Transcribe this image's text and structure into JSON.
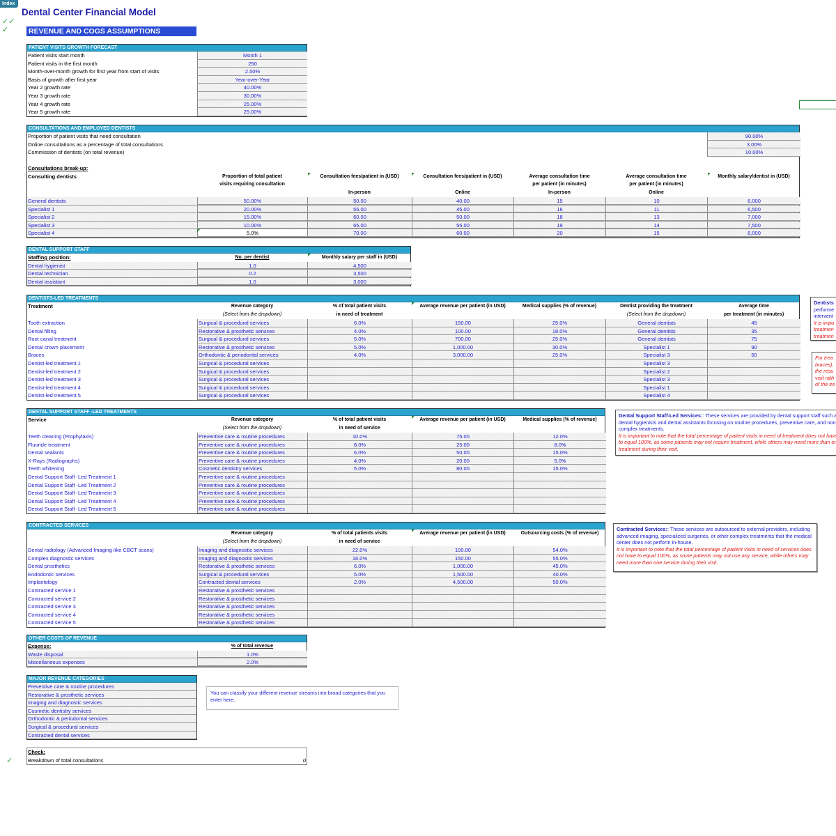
{
  "index_button": "Index",
  "title": "Dental Center Financial Model",
  "check_marks": [
    "✓✓",
    "✓"
  ],
  "section_title": "REVENUE AND COGS ASSUMPTIONS",
  "growth": {
    "header": "PATIENT VISITS GROWTH FORECAST",
    "rows": [
      {
        "label": "Patient visits start month",
        "value": "Month 1"
      },
      {
        "label": "Patient visits in the first month",
        "value": "250"
      },
      {
        "label": "Month-over-month growth for first year from start of visits",
        "value": "2.50%"
      },
      {
        "label": "Basis of growth after first year",
        "value": "Year-over-Year"
      },
      {
        "label": "Year 2 growth rate",
        "value": "40.00%"
      },
      {
        "label": "Year 3 growth rate",
        "value": "30.00%"
      },
      {
        "label": "Year 4 growth rate",
        "value": "25.00%"
      },
      {
        "label": "Year 5 growth rate",
        "value": "25.00%"
      }
    ]
  },
  "consult": {
    "header": "CONSULTATIONS AND EMPLOYED DENTISTS",
    "params": [
      {
        "label": "Proportion of patient visits that need consultation",
        "value": "90.00%"
      },
      {
        "label": "Online consultations as a percentage of total consultations",
        "value": "3.00%"
      },
      {
        "label": "Commission of dentists (on total revenue)",
        "value": "10.00%"
      }
    ],
    "breakup_label": "Consultations break-up:",
    "col_headers": {
      "name": "Consulting dentists",
      "proportion_1": "Proportion of total patient",
      "proportion_2": "visits requiring consultation",
      "fee_in": "Consultation fees/patient  in (USD)",
      "fee_in_sub": "In-person",
      "fee_on": "Consultation fees/patient  in (USD)",
      "fee_on_sub": "Online",
      "time_in_1": "Average consultation time",
      "time_in_2": "per patient (in minutes)",
      "time_in_sub": "In-person",
      "time_on_1": "Average consultation time",
      "time_on_2": "per patient (in minutes)",
      "time_on_sub": "Online",
      "salary": "Monthly salary/dentist  in (USD)"
    },
    "rows": [
      {
        "name": "General dentists",
        "proportion": "50.00%",
        "fee_in": "50.00",
        "fee_on": "40.00",
        "time_in": "15",
        "time_on": "10",
        "salary": "6,000"
      },
      {
        "name": "Specialist 1",
        "proportion": "20.00%",
        "fee_in": "55.00",
        "fee_on": "45.00",
        "time_in": "16",
        "time_on": "11",
        "salary": "6,500"
      },
      {
        "name": "Specialist 2",
        "proportion": "15.00%",
        "fee_in": "60.00",
        "fee_on": "50.00",
        "time_in": "18",
        "time_on": "13",
        "salary": "7,000"
      },
      {
        "name": "Specialist 3",
        "proportion": "10.00%",
        "fee_in": "65.00",
        "fee_on": "55.00",
        "time_in": "19",
        "time_on": "14",
        "salary": "7,500"
      },
      {
        "name": "Specialist 4",
        "proportion": "5.0%",
        "fee_in": "70.00",
        "fee_on": "60.00",
        "time_in": "20",
        "time_on": "15",
        "salary": "8,000"
      }
    ]
  },
  "staff": {
    "header": "DENTAL SUPPORT STAFF",
    "col_headers": {
      "position": "Staffing position:",
      "per_dentist": "No. per dentist",
      "salary": "Monthly salary per staff in (USD)"
    },
    "rows": [
      {
        "position": "Dental hygienist",
        "per_dentist": "1.0",
        "salary": "4,500"
      },
      {
        "position": "Dental technician",
        "per_dentist": "0.2",
        "salary": "3,500"
      },
      {
        "position": "Dental assistant",
        "per_dentist": "1.0",
        "salary": "3,000"
      }
    ]
  },
  "dentist_treatments": {
    "header": "DENTISTS-LED TREATMENTS",
    "col_headers": {
      "name": "Treatment",
      "category": "Revenue category",
      "category_sub": "(Select from the dropdown)",
      "pct_1": "% of total patient visits",
      "pct_2": "in need of treatment",
      "revenue": "Average revenue per patient (in USD)",
      "supplies": "Medical supplies (% of revenue)",
      "dentist": "Dentist providing the treatment",
      "dentist_sub": "(Select from the dropdown)",
      "time_1": "Average time",
      "time_2": "per treatment (in minutes)"
    },
    "rows": [
      {
        "name": "Tooth extraction",
        "category": "Surgical & procedural services",
        "pct": "6.0%",
        "revenue": "150.00",
        "supplies": "25.0%",
        "dentist": "General dentists",
        "time": "45"
      },
      {
        "name": "Dental filling",
        "category": "Restorative & prosthetic services",
        "pct": "4.0%",
        "revenue": "100.00",
        "supplies": "18.0%",
        "dentist": "General dentists",
        "time": "35"
      },
      {
        "name": "Root canal treatment",
        "category": "Surgical & procedural services",
        "pct": "5.0%",
        "revenue": "700.00",
        "supplies": "25.0%",
        "dentist": "General dentists",
        "time": "75"
      },
      {
        "name": "Dental crown placement",
        "category": "Restorative & prosthetic services",
        "pct": "5.0%",
        "revenue": "1,000.00",
        "supplies": "30.0%",
        "dentist": "Specialist 1",
        "time": "90"
      },
      {
        "name": "Braces",
        "category": "Orthodontic & periodontal services",
        "pct": "4.0%",
        "revenue": "3,000.00",
        "supplies": "25.0%",
        "dentist": "Specialist 3",
        "time": "50"
      },
      {
        "name": "Dentist-led treatment 1",
        "category": "Surgical & procedural services",
        "pct": "",
        "revenue": "",
        "supplies": "",
        "dentist": "Specialist 3",
        "time": ""
      },
      {
        "name": "Dentist-led treatment 2",
        "category": "Surgical & procedural services",
        "pct": "",
        "revenue": "",
        "supplies": "",
        "dentist": "Specialist 2",
        "time": ""
      },
      {
        "name": "Dentist-led treatment 3",
        "category": "Surgical & procedural services",
        "pct": "",
        "revenue": "",
        "supplies": "",
        "dentist": "Specialist 3",
        "time": ""
      },
      {
        "name": "Dentist-led treatment 4",
        "category": "Surgical & procedural services",
        "pct": "",
        "revenue": "",
        "supplies": "",
        "dentist": "Specialist 1",
        "time": ""
      },
      {
        "name": "Dentist-led treatment 5",
        "category": "Surgical & procedural services",
        "pct": "",
        "revenue": "",
        "supplies": "",
        "dentist": "Specialist 4",
        "time": ""
      }
    ],
    "note_1": {
      "title": "Dentists",
      "lines": [
        "performe",
        "intervent"
      ],
      "red": [
        "It is impo",
        "treatmen",
        "treatmen"
      ]
    },
    "note_2": {
      "red": [
        "For trea",
        "braces),",
        "the resu",
        "visit rath",
        "of the tre"
      ]
    }
  },
  "support_treatments": {
    "header": "DENTAL SUPPORT STAFF -LED TREATMENTS",
    "col_headers": {
      "name": "Service",
      "category": "Revenue category",
      "category_sub": "(Select from the dropdown)",
      "pct_1": "% of total patient visits",
      "pct_2": "in need of service",
      "revenue": "Average revenue per patient (in USD)",
      "supplies": "Medical supplies (% of revenue)"
    },
    "rows": [
      {
        "name": "Teeth cleaning (Prophylaxis)",
        "category": "Preventive care & routine procedures",
        "pct": "10.0%",
        "revenue": "75.00",
        "supplies": "12.0%"
      },
      {
        "name": "Fluoride treatment",
        "category": "Preventive care & routine procedures",
        "pct": "8.0%",
        "revenue": "25.00",
        "supplies": "8.0%"
      },
      {
        "name": "Dental sealants",
        "category": "Preventive care & routine procedures",
        "pct": "6.0%",
        "revenue": "50.00",
        "supplies": "15.0%"
      },
      {
        "name": "X-Rays (Radiographs)",
        "category": "Preventive care & routine procedures",
        "pct": "4.0%",
        "revenue": "20.00",
        "supplies": "5.0%"
      },
      {
        "name": "Teeth whitening",
        "category": "Cosmetic dentistry services",
        "pct": "5.0%",
        "revenue": "80.00",
        "supplies": "15.0%"
      },
      {
        "name": "Dental Support Staff -Led Treatment 1",
        "category": "Preventive care & routine procedures",
        "pct": "",
        "revenue": "",
        "supplies": ""
      },
      {
        "name": "Dental Support Staff -Led Treatment 2",
        "category": "Preventive care & routine procedures",
        "pct": "",
        "revenue": "",
        "supplies": ""
      },
      {
        "name": "Dental Support Staff -Led Treatment 3",
        "category": "Preventive care & routine procedures",
        "pct": "",
        "revenue": "",
        "supplies": ""
      },
      {
        "name": "Dental Support Staff -Led Treatment 4",
        "category": "Preventive care & routine procedures",
        "pct": "",
        "revenue": "",
        "supplies": ""
      },
      {
        "name": "Dental Support Staff -Led Treatment 5",
        "category": "Preventive care & routine procedures",
        "pct": "",
        "revenue": "",
        "supplies": ""
      }
    ],
    "note": {
      "title": "Dental Support Staff-Led Services:",
      "text": ": These services are provided by dental support staff such as dental hygienists and dental assistants  focusing on routine procedures, preventive care, and non-complex treatments.",
      "red": "It is  important to note that the total percentage of patient visits in need of treatment does not have to equal 100%, as some patients may not require treatment, while others may need more than one treatment during their visit."
    }
  },
  "contracted": {
    "header": "CONTRACTED SERVICES",
    "col_headers": {
      "category": "Revenue category",
      "category_sub": "(Select from the dropdown)",
      "pct_1": "% of total patients visits",
      "pct_2": "in need of service",
      "revenue": "Average revenue per patient (in USD)",
      "outsourcing": "Outsourcing costs (% of revenue)"
    },
    "rows": [
      {
        "name": "Dental radiology (Advanced Imaging like CBCT scans)",
        "category": "Imaging and diagnostic services",
        "pct": "22.0%",
        "revenue": "100.00",
        "outsourcing": "54.0%"
      },
      {
        "name": "Complex diagnostic services",
        "category": "Imaging and diagnostic services",
        "pct": "16.0%",
        "revenue": "150.00",
        "outsourcing": "55.0%"
      },
      {
        "name": "Dental prosthetics",
        "category": "Restorative & prosthetic services",
        "pct": "6.0%",
        "revenue": "1,000.00",
        "outsourcing": "45.0%"
      },
      {
        "name": "Endodontic services",
        "category": "Surgical & procedural services",
        "pct": "5.0%",
        "revenue": "1,500.00",
        "outsourcing": "40.0%"
      },
      {
        "name": "Implantology",
        "category": "Contracted dental services",
        "pct": "2.0%",
        "revenue": "4,500.00",
        "outsourcing": "50.0%"
      },
      {
        "name": "Contracted service 1",
        "category": "Restorative & prosthetic services",
        "pct": "",
        "revenue": "",
        "outsourcing": ""
      },
      {
        "name": "Contracted service 2",
        "category": "Restorative & prosthetic services",
        "pct": "",
        "revenue": "",
        "outsourcing": ""
      },
      {
        "name": "Contracted service 3",
        "category": "Restorative & prosthetic services",
        "pct": "",
        "revenue": "",
        "outsourcing": ""
      },
      {
        "name": "Contracted service 4",
        "category": "Restorative & prosthetic services",
        "pct": "",
        "revenue": "",
        "outsourcing": ""
      },
      {
        "name": "Contracted service 5",
        "category": "Restorative & prosthetic services",
        "pct": "",
        "revenue": "",
        "outsourcing": ""
      }
    ],
    "note": {
      "title": "Contracted Services:",
      "text": ": These services are outsourced to external providers, including advanced imaging, specialized surgeries, or other complex treatments that the medical center does not perform in-house.",
      "red": "It is  important to note that the total percentage of patient visits in need of services  does not have to equal 100%, as some patients may not use any service, while others may need more than one service during their visit."
    }
  },
  "other_costs": {
    "header": "OTHER COSTS OF REVENUE",
    "col_headers": {
      "expense": "Expense:",
      "pct": "% of total revenue"
    },
    "rows": [
      {
        "expense": "Waste disposal",
        "pct": "1.0%"
      },
      {
        "expense": "Miscellaneous expenses",
        "pct": "2.0%"
      }
    ]
  },
  "categories": {
    "header": "MAJOR REVENUE CATEGORIES",
    "items": [
      "Preventive care & routine procedures",
      "Restorative & prosthetic services",
      "Imaging and diagnostic services",
      "Cosmetic dentistry services",
      "Orthodontic & periodontal services",
      "Surgical & procedural services",
      "Contracted dental services"
    ],
    "note": "You can classify your different revenue streams into broad categories that you enter here."
  },
  "check": {
    "label": "Check:",
    "row_label": "Breakdown of total consultations",
    "row_value": "0",
    "mark": "✓"
  }
}
